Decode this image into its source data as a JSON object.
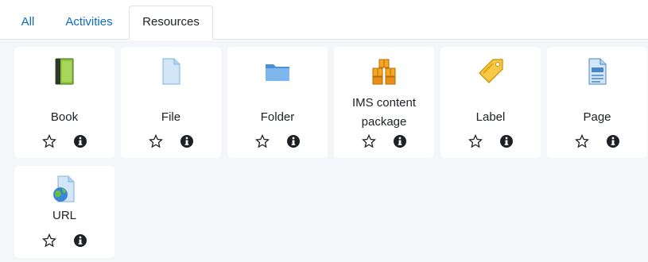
{
  "tabs": [
    {
      "label": "All"
    },
    {
      "label": "Activities"
    },
    {
      "label": "Resources"
    }
  ],
  "resources": [
    {
      "name": "Book",
      "icon": "book-icon"
    },
    {
      "name": "File",
      "icon": "file-icon"
    },
    {
      "name": "Folder",
      "icon": "folder-icon"
    },
    {
      "name_line1": "IMS content",
      "name_line2": "package",
      "icon": "ims-package-icon"
    },
    {
      "name": "Label",
      "icon": "label-tag-icon"
    },
    {
      "name": "Page",
      "icon": "page-icon"
    },
    {
      "name": "URL",
      "icon": "url-globe-icon"
    }
  ],
  "colors": {
    "link": "#0f6cbf",
    "panel_bg": "#f4f6f9",
    "text": "#1d2125"
  }
}
